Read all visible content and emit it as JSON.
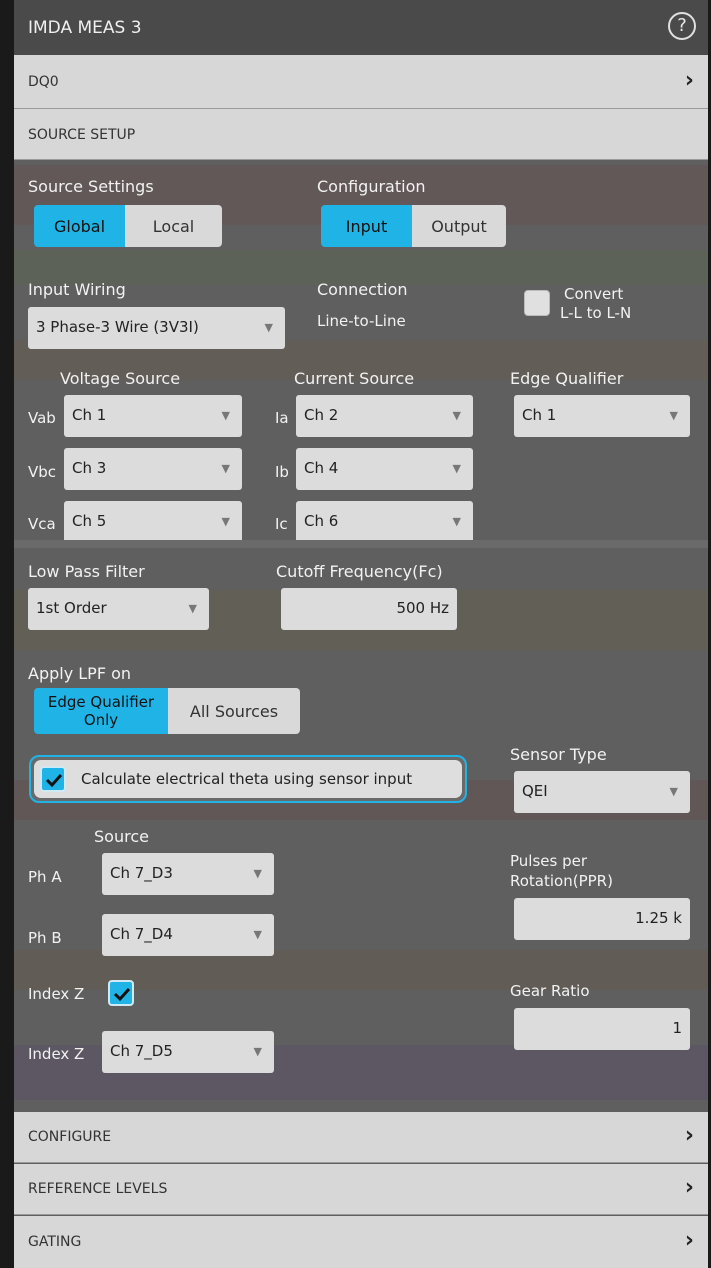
{
  "title": "IMDA MEAS 3",
  "help_icon": "help-circle-icon",
  "sections": {
    "dq0": "DQ0",
    "source_setup": "SOURCE SETUP",
    "configure": "CONFIGURE",
    "reference_levels": "REFERENCE LEVELS",
    "gating": "GATING"
  },
  "source_settings": {
    "label": "Source Settings",
    "options": [
      "Global",
      "Local"
    ],
    "selected": "Global"
  },
  "configuration": {
    "label": "Configuration",
    "options": [
      "Input",
      "Output"
    ],
    "selected": "Input"
  },
  "input_wiring": {
    "label": "Input Wiring",
    "value": "3 Phase-3 Wire (3V3I)"
  },
  "connection": {
    "label": "Connection",
    "value": "Line-to-Line"
  },
  "convert": {
    "line1": "Convert",
    "line2": "L-L to L-N",
    "checked": false
  },
  "voltage_source": {
    "label": "Voltage Source",
    "rows": [
      {
        "name": "Vab",
        "value": "Ch 1"
      },
      {
        "name": "Vbc",
        "value": "Ch 3"
      },
      {
        "name": "Vca",
        "value": "Ch 5"
      }
    ]
  },
  "current_source": {
    "label": "Current Source",
    "rows": [
      {
        "name": "Ia",
        "value": "Ch 2"
      },
      {
        "name": "Ib",
        "value": "Ch 4"
      },
      {
        "name": "Ic",
        "value": "Ch 6"
      }
    ]
  },
  "edge_qualifier": {
    "label": "Edge Qualifier",
    "value": "Ch 1"
  },
  "low_pass_filter": {
    "label": "Low Pass Filter",
    "value": "1st Order"
  },
  "cutoff": {
    "label": "Cutoff Frequency(Fc)",
    "value": "500 Hz"
  },
  "apply_lpf": {
    "label": "Apply LPF on",
    "option1_line1": "Edge Qualifier",
    "option1_line2": "Only",
    "option2": "All Sources",
    "selected": "Edge Qualifier Only"
  },
  "theta": {
    "label": "Calculate electrical theta using sensor input",
    "checked": true
  },
  "sensor_type": {
    "label": "Sensor Type",
    "value": "QEI"
  },
  "source_col": {
    "label": "Source"
  },
  "ph_a": {
    "label": "Ph A",
    "value": "Ch 7_D3"
  },
  "ph_b": {
    "label": "Ph B",
    "value": "Ch 7_D4"
  },
  "index_z_enable": {
    "label": "Index Z",
    "checked": true
  },
  "index_z": {
    "label": "Index Z",
    "value": "Ch 7_D5"
  },
  "ppr": {
    "label_line1": "Pulses per",
    "label_line2": "Rotation(PPR)",
    "value": "1.25 k"
  },
  "gear_ratio": {
    "label": "Gear Ratio",
    "value": "1"
  },
  "colors": {
    "accent": "#1fb3e6",
    "panel": "#5f5f5f",
    "title_bar": "#4a4a4a",
    "section_bar": "#d7d7d7"
  }
}
